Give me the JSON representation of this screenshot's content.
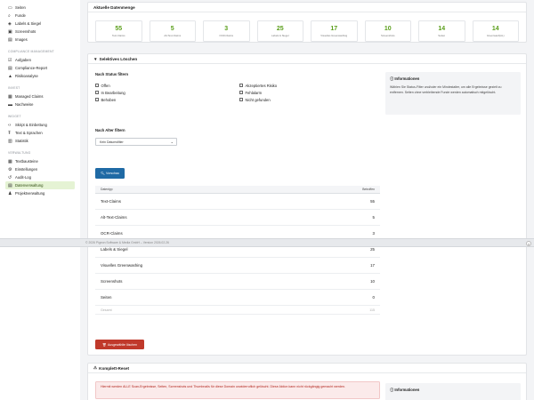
{
  "sidebar": {
    "top_items": [
      {
        "label": "Seiten",
        "icon": "page-icon"
      },
      {
        "label": "Funde",
        "icon": "search-icon"
      },
      {
        "label": "Labels & Siegel",
        "icon": "tag-icon"
      },
      {
        "label": "Screenshots",
        "icon": "camera-icon"
      },
      {
        "label": "Images",
        "icon": "image-icon"
      }
    ],
    "section_compliance": "Compliance Management",
    "compliance_items": [
      {
        "label": "Aufgaben",
        "icon": "task-icon"
      },
      {
        "label": "Compliance-Report",
        "icon": "report-icon"
      },
      {
        "label": "Risikoanalyse",
        "icon": "warning-icon"
      }
    ],
    "section_invest": "Invest",
    "invest_items": [
      {
        "label": "Managed Claims",
        "icon": "claims-icon"
      },
      {
        "label": "Nachweise",
        "icon": "folder-icon"
      }
    ],
    "section_widget": "Widget",
    "widget_items": [
      {
        "label": "Skript & Einbettung",
        "icon": "code-icon"
      },
      {
        "label": "Text & Sprachen",
        "icon": "text-icon"
      },
      {
        "label": "Statistik",
        "icon": "chart-icon"
      }
    ],
    "section_admin": "Verwaltung",
    "admin_items": [
      {
        "label": "Textbausteine",
        "icon": "blocks-icon"
      },
      {
        "label": "Einstellungen",
        "icon": "gear-icon"
      },
      {
        "label": "Audit-Log",
        "icon": "history-icon"
      },
      {
        "label": "Datenverwaltung",
        "icon": "database-icon",
        "active": true
      },
      {
        "label": "Projektverwaltung",
        "icon": "projects-icon"
      }
    ]
  },
  "stats": {
    "title": "Aktuelle Datenmenge",
    "items": [
      {
        "value": "55",
        "label": "Text-Claims"
      },
      {
        "value": "5",
        "label": "Alt-Text-Claims"
      },
      {
        "value": "3",
        "label": "OCR-Claims"
      },
      {
        "value": "25",
        "label": "Labels & Siegel"
      },
      {
        "value": "17",
        "label": "Visuelles Greenwashing"
      },
      {
        "value": "10",
        "label": "Screenshots"
      },
      {
        "value": "14",
        "label": "Seiten"
      },
      {
        "value": "14",
        "label": "Greenwash(AL)"
      }
    ]
  },
  "selective": {
    "title": "Selektives Löschen",
    "status_label": "Nach Status filtern",
    "statuses_left": [
      "Offen",
      "In Bearbeitung",
      "Behoben"
    ],
    "statuses_right": [
      "Akzeptiertes Risiko",
      "Fehlalarm",
      "Nicht gefunden"
    ],
    "age_label": "Nach Alter filtern",
    "age_value": "Kein Datumsfilter",
    "preview_button": "Vorschau",
    "table_headers": [
      "Datentyp",
      "Betroffen"
    ],
    "rows": [
      {
        "type": "Text-Claims",
        "count": "55"
      },
      {
        "type": "Alt-Text-Claims",
        "count": "5"
      },
      {
        "type": "OCR-Claims",
        "count": "3"
      },
      {
        "type": "Labels & Siegel",
        "count": "25"
      },
      {
        "type": "Visuelles Greenwashing",
        "count": "17"
      },
      {
        "type": "Screenshots",
        "count": "10"
      },
      {
        "type": "Seiten",
        "count": "0"
      }
    ],
    "total_label": "Gesamt",
    "total_value": "115",
    "delete_button": "Ausgewählte löschen",
    "info_title": "Informationen",
    "info_text": "Wählen Sie Status-Filter und/oder ein Mindestalter, um alle Ergebnisse gezielt zu entfernen. Seiten ohne verbleibende Funde werden automatisch mitgelöscht."
  },
  "reset": {
    "title": "Komplett-Reset",
    "alert": "Hiermit werden ALLE Scan-Ergebnisse, Seiten, Screenshots und Thumbnails für diese Domain unwiderruflich gelöscht. Diese Aktion kann nicht rückgängig gemacht werden.",
    "info_title": "Informationen"
  },
  "footer": {
    "text": "© 2026 Pigeon Software & Media GmbH – Version 2026.02.26"
  },
  "colors": {
    "accent": "#5a9e1a",
    "primary_button": "#1f6aa5",
    "danger": "#c0392b",
    "active_nav_bg": "#e5f3d4"
  }
}
